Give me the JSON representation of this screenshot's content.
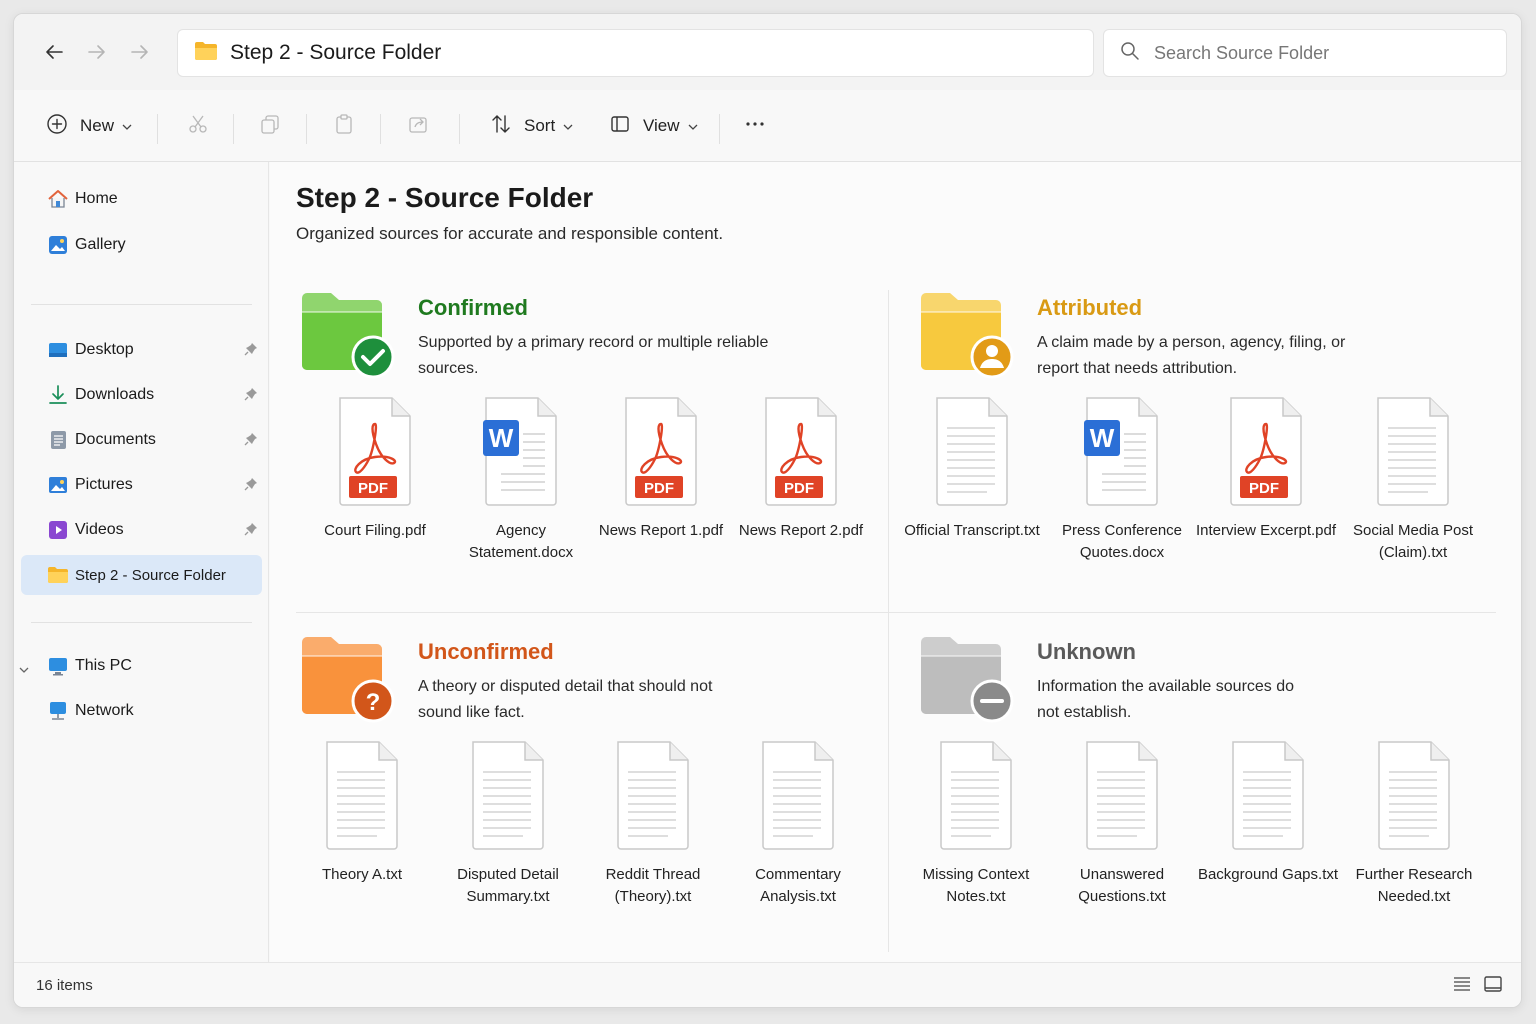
{
  "window": {
    "address": {
      "breadcrumb": "Step 2 - Source Folder"
    },
    "search": {
      "placeholder": "Search Source Folder"
    }
  },
  "toolbar": {
    "new_label": "New",
    "sort_label": "Sort",
    "view_label": "View"
  },
  "sidebar": {
    "items": [
      {
        "label": "Home",
        "icon": "home-icon"
      },
      {
        "label": "Gallery",
        "icon": "gallery-icon"
      },
      {
        "label": "Desktop",
        "icon": "desktop-icon",
        "pinned": true
      },
      {
        "label": "Downloads",
        "icon": "downloads-icon",
        "pinned": true
      },
      {
        "label": "Documents",
        "icon": "documents-icon",
        "pinned": true
      },
      {
        "label": "Pictures",
        "icon": "pictures-icon",
        "pinned": true
      },
      {
        "label": "Videos",
        "icon": "videos-icon",
        "pinned": true
      },
      {
        "label": "Step 2 - Source Folder",
        "icon": "folder-icon",
        "selected": true
      },
      {
        "label": "This PC",
        "icon": "pc-icon"
      },
      {
        "label": "Network",
        "icon": "network-icon"
      }
    ]
  },
  "main": {
    "title": "Step 2 - Source Folder",
    "subtitle": "Organized sources for accurate and responsible content.",
    "sections": [
      {
        "title": "Confirmed",
        "color": "#1f7a1f",
        "folder_color": "#6cc83f",
        "badge": "check-icon",
        "description": "Supported by a primary record or multiple reliable sources.",
        "files": [
          {
            "name": "Court Filing.pdf",
            "type": "pdf"
          },
          {
            "name": "Agency Statement.docx",
            "type": "docx"
          },
          {
            "name": "News Report 1.pdf",
            "type": "pdf"
          },
          {
            "name": "News Report 2.pdf",
            "type": "pdf"
          }
        ]
      },
      {
        "title": "Attributed",
        "color": "#d99a14",
        "folder_color": "#f7c93e",
        "badge": "person-icon",
        "description": "A claim made by a person, agency, filing, or report that needs attribution.",
        "files": [
          {
            "name": "Official Transcript.txt",
            "type": "txt"
          },
          {
            "name": "Press Conference Quotes.docx",
            "type": "docx"
          },
          {
            "name": "Interview Excerpt.pdf",
            "type": "pdf"
          },
          {
            "name": "Social Media Post (Claim).txt",
            "type": "txt"
          }
        ]
      },
      {
        "title": "Unconfirmed",
        "color": "#d2561a",
        "folder_color": "#f9923c",
        "badge": "question-icon",
        "description": "A theory or disputed detail that should not sound like fact.",
        "files": [
          {
            "name": "Theory A.txt",
            "type": "txt"
          },
          {
            "name": "Disputed Detail Summary.txt",
            "type": "txt"
          },
          {
            "name": "Reddit Thread (Theory).txt",
            "type": "txt"
          },
          {
            "name": "Commentary Analysis.txt",
            "type": "txt"
          }
        ]
      },
      {
        "title": "Unknown",
        "color": "#5a5a5a",
        "folder_color": "#bdbdbd",
        "badge": "minus-icon",
        "description": "Information the available sources do not establish.",
        "files": [
          {
            "name": "Missing Context Notes.txt",
            "type": "txt"
          },
          {
            "name": "Unanswered Questions.txt",
            "type": "txt"
          },
          {
            "name": "Background Gaps.txt",
            "type": "txt"
          },
          {
            "name": "Further Research Needed.txt",
            "type": "txt"
          }
        ]
      }
    ]
  },
  "status": {
    "item_count": "16 items"
  }
}
